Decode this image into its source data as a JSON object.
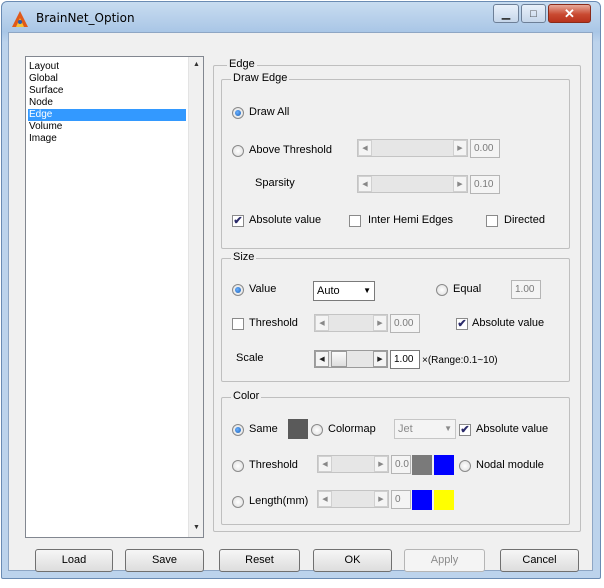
{
  "window": {
    "title": "BrainNet_Option",
    "minimize_glyph": "▁",
    "maximize_glyph": "□",
    "close_glyph": "✕"
  },
  "sidebar": {
    "items": [
      {
        "label": "Layout"
      },
      {
        "label": "Global"
      },
      {
        "label": "Surface"
      },
      {
        "label": "Node"
      },
      {
        "label": "Edge",
        "selected": true
      },
      {
        "label": "Volume"
      },
      {
        "label": "Image"
      }
    ],
    "scroll_up": "▲",
    "scroll_down": "▼"
  },
  "edge_panel": {
    "title": "Edge",
    "draw_edge": {
      "title": "Draw Edge",
      "draw_all_label": "Draw All",
      "draw_all_selected": true,
      "above_threshold_label": "Above Threshold",
      "above_threshold_selected": false,
      "threshold_value": "0.00",
      "sparsity_label": "Sparsity",
      "sparsity_value": "0.10",
      "absolute_value_label": "Absolute value",
      "absolute_value_checked": true,
      "inter_hemi_label": "Inter Hemi Edges",
      "inter_hemi_checked": false,
      "directed_label": "Directed",
      "directed_checked": false
    },
    "size": {
      "title": "Size",
      "value_label": "Value",
      "value_selected": true,
      "value_option": "Auto",
      "equal_label": "Equal",
      "equal_selected": false,
      "equal_value": "1.00",
      "threshold_label": "Threshold",
      "threshold_checked": false,
      "threshold_value": "0.00",
      "absolute_value_label": "Absolute value",
      "absolute_value_checked": true,
      "scale_label": "Scale",
      "scale_value": "1.00",
      "scale_range": "×(Range:0.1~10)"
    },
    "color": {
      "title": "Color",
      "same_label": "Same",
      "same_selected": true,
      "same_color": "#5a5a5a",
      "colormap_label": "Colormap",
      "colormap_selected": false,
      "colormap_option": "Jet",
      "absolute_value_label": "Absolute value",
      "absolute_value_checked": true,
      "threshold_label": "Threshold",
      "threshold_selected": false,
      "threshold_value": "0.0",
      "threshold_color_low": "#7a7a7a",
      "threshold_color_high": "#0000ff",
      "nodal_module_label": "Nodal module",
      "nodal_module_selected": false,
      "length_label": "Length(mm)",
      "length_selected": false,
      "length_value": "0",
      "length_color_low": "#0000ff",
      "length_color_high": "#ffff00"
    }
  },
  "buttons": {
    "load": "Load",
    "save": "Save",
    "reset": "Reset",
    "ok": "OK",
    "apply": "Apply",
    "cancel": "Cancel"
  },
  "icons": {
    "app": "brainnet-app-icon",
    "slider_left": "◀",
    "slider_right": "▶",
    "dropdown": "▼",
    "check": "✔"
  }
}
